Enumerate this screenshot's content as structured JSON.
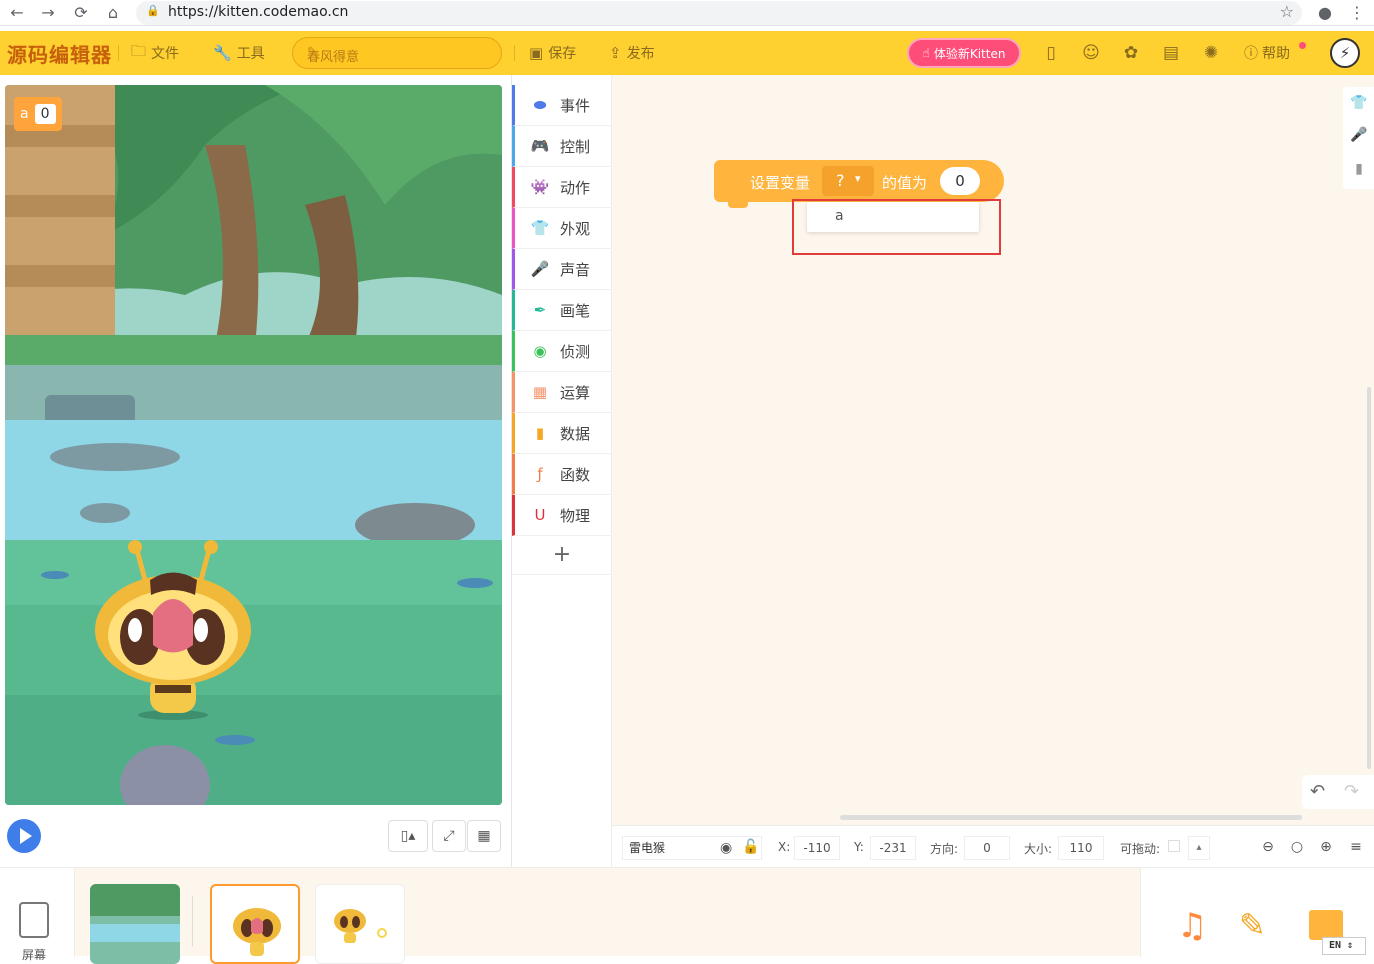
{
  "browser": {
    "url": "https://kitten.codemao.cn",
    "back": "←",
    "forward": "→",
    "reload": "⟳",
    "home": "⌂",
    "lock": "🔒",
    "star": "☆",
    "account": "●",
    "menu": "⋮"
  },
  "header": {
    "logo": "源码编辑器",
    "file_label": "文件",
    "tools_label": "工具",
    "project_name": "春风得意",
    "save_label": "保存",
    "publish_label": "发布",
    "try_new_label": "体验新Kitten",
    "help_label": "帮助",
    "brand_color": "#fed030"
  },
  "stage": {
    "variable_name": "a",
    "variable_value": "0"
  },
  "categories": [
    {
      "label": "事件",
      "icon": "toggle-icon",
      "color": "#4f7be8"
    },
    {
      "label": "控制",
      "icon": "gamepad-icon",
      "color": "#4aa8e8"
    },
    {
      "label": "动作",
      "icon": "ghost-icon",
      "color": "#ee4b61"
    },
    {
      "label": "外观",
      "icon": "shirt-icon",
      "color": "#e956c8"
    },
    {
      "label": "声音",
      "icon": "mic-icon",
      "color": "#a157e8"
    },
    {
      "label": "画笔",
      "icon": "pen-icon",
      "color": "#23b898"
    },
    {
      "label": "侦测",
      "icon": "target-icon",
      "color": "#3cc25c"
    },
    {
      "label": "运算",
      "icon": "calc-icon",
      "color": "#f5936b"
    },
    {
      "label": "数据",
      "icon": "bar-chart-icon",
      "color": "#f5a623"
    },
    {
      "label": "函数",
      "icon": "function-icon",
      "color": "#f07d4a"
    },
    {
      "label": "物理",
      "icon": "magnet-icon",
      "color": "#d8343a"
    }
  ],
  "add_category": "+",
  "workspace": {
    "block_label_1": "设置变量",
    "block_var_placeholder": "?",
    "block_label_2": "的值为",
    "block_value": "0",
    "dropdown_options": [
      "a"
    ],
    "block_color": "#ffb43e"
  },
  "properties": {
    "sprite_name": "雷电猴",
    "x_label": "X:",
    "x_value": "-110",
    "y_label": "Y:",
    "y_value": "-231",
    "direction_label": "方向:",
    "direction_value": "0",
    "size_label": "大小:",
    "size_value": "110",
    "draggable_label": "可拖动:"
  },
  "bottom": {
    "screen_label": "屏幕",
    "lang": "EN"
  }
}
